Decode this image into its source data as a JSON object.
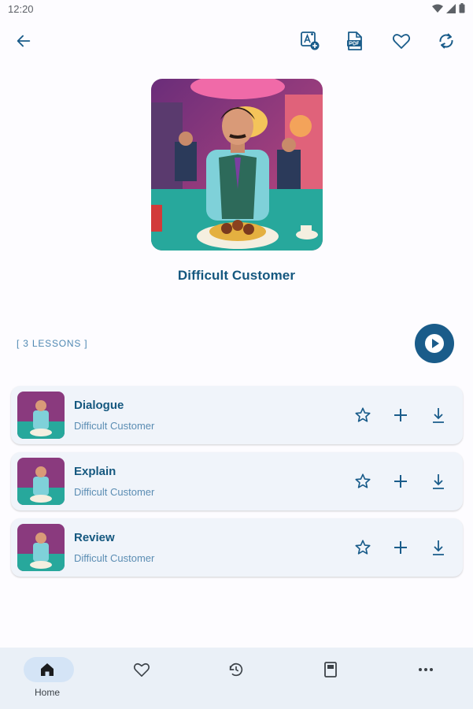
{
  "status_bar": {
    "time": "12:20"
  },
  "course": {
    "title": "Difficult Customer",
    "lessons_count": "[ 3 LESSONS ]"
  },
  "lessons": [
    {
      "name": "Dialogue",
      "subtitle": "Difficult Customer"
    },
    {
      "name": "Explain",
      "subtitle": "Difficult Customer"
    },
    {
      "name": "Review",
      "subtitle": "Difficult Customer"
    }
  ],
  "bottom_nav": {
    "items": [
      {
        "label": "Home",
        "icon": "home-icon",
        "active": true
      },
      {
        "label": "",
        "icon": "heart-icon",
        "active": false
      },
      {
        "label": "",
        "icon": "history-icon",
        "active": false
      },
      {
        "label": "",
        "icon": "book-icon",
        "active": false
      },
      {
        "label": "",
        "icon": "more-icon",
        "active": false
      }
    ]
  },
  "colors": {
    "accent": "#1a5c8a",
    "title": "#15587f",
    "subtitle": "#5b8db3",
    "card": "#f0f4fa",
    "nav": "#eaf0f7"
  }
}
